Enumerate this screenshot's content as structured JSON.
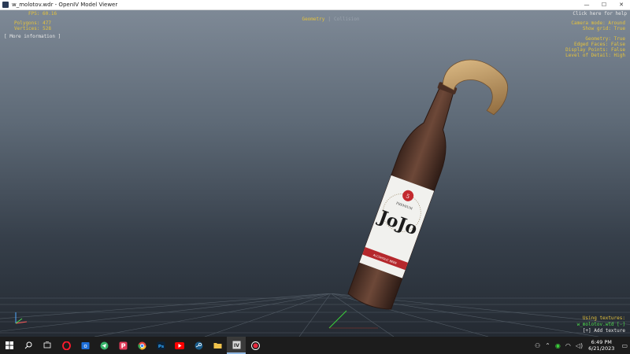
{
  "window": {
    "title": "w_molotov.wdr - OpenIV Model Viewer",
    "min_glyph": "—",
    "max_glyph": "☐",
    "close_glyph": "✕"
  },
  "hud": {
    "fps": "FPS: 60.16",
    "polygons": "Polygons: 477",
    "vertices": "Vertices: 528",
    "more_info": "[ More information ]",
    "mode_geometry": "Geometry",
    "mode_sep": "|",
    "mode_collision": "Collision",
    "help": "Click here for help",
    "camera_mode": "Camera mode: Around",
    "show_grid": "Show grid: True",
    "geometry": "Geometry: True",
    "edged_faces": "Edged Faces: False",
    "display_points": "Display Points: False",
    "level_of_detail": "Level of Detail: High",
    "using_textures": "Using textures:",
    "texture_file": "w_molotov.wtd [-]",
    "add_texture": "[+] Add texture"
  },
  "label": {
    "brand": "JoJo",
    "premium": "PREMIUM",
    "sub": "ALCOHOLIC BEER"
  },
  "taskbar": {
    "time": "6:49 PM",
    "date": "6/21/2023"
  },
  "colors": {
    "hud_yellow": "#e6c33b",
    "hud_green": "#4fdc4f",
    "bottle_brown": "#5a3a2e",
    "taskbar": "#1c1c1c"
  }
}
